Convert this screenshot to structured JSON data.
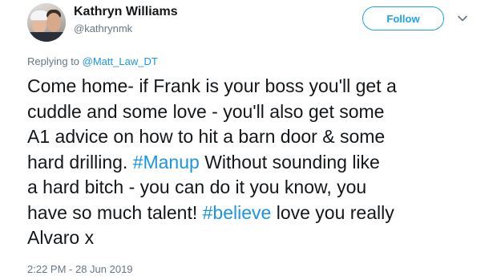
{
  "author": {
    "display_name": "Kathryn Williams",
    "handle": "@kathrynmk"
  },
  "follow_button": {
    "label": "Follow"
  },
  "reply": {
    "prefix": "Replying to ",
    "mention": "@Matt_Law_DT"
  },
  "tweet": {
    "lines": [
      "Come home- if Frank is your boss you'll get a",
      "cuddle and some love - you'll also get some",
      "A1 advice on how to hit a barn door & some",
      "hard drilling. ",
      "#Manup",
      " Without sounding like",
      "a hard bitch - you can do it you know, you",
      "have so much talent! ",
      "#believe",
      " love you really",
      "Alvaro x"
    ]
  },
  "timestamp": "2:22 PM - 28 Jun 2019",
  "colors": {
    "accent": "#1da1f2",
    "link": "#1b95e0",
    "secondary_text": "#657786",
    "primary_text": "#14171a"
  },
  "icons": {
    "caret": "chevron-down-icon"
  }
}
